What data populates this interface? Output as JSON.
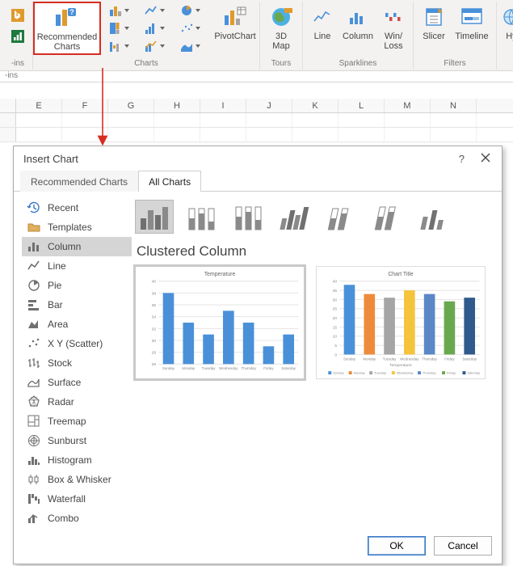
{
  "ribbon": {
    "groups": {
      "illustrations_label": "-ins",
      "addins": {
        "label": "-ins"
      },
      "charts": {
        "recommended": "Recommended\nCharts",
        "pivot": "PivotChart",
        "label": "Charts"
      },
      "tours": {
        "map": "3D\nMap",
        "label": "Tours"
      },
      "sparklines": {
        "line": "Line",
        "column": "Column",
        "winloss": "Win/\nLoss",
        "label": "Sparklines"
      },
      "filters": {
        "slicer": "Slicer",
        "timeline": "Timeline",
        "label": "Filters"
      },
      "hyperlinks": {
        "h": "Hy"
      }
    }
  },
  "sheet": {
    "cols": [
      "E",
      "F",
      "G",
      "H",
      "I",
      "J",
      "K",
      "L",
      "M",
      "N"
    ]
  },
  "dialog": {
    "title": "Insert Chart",
    "help": "?",
    "tabs": {
      "recommended": "Recommended Charts",
      "all": "All Charts"
    },
    "categories": [
      "Recent",
      "Templates",
      "Column",
      "Line",
      "Pie",
      "Bar",
      "Area",
      "X Y (Scatter)",
      "Stock",
      "Surface",
      "Radar",
      "Treemap",
      "Sunburst",
      "Histogram",
      "Box & Whisker",
      "Waterfall",
      "Combo"
    ],
    "chart_type_title": "Clustered Column",
    "preview1_title": "Temperature",
    "preview2_title": "Chart Title",
    "preview2_axis_title": "Temperature",
    "ok": "OK",
    "cancel": "Cancel"
  },
  "chart_data": [
    {
      "type": "bar",
      "title": "Temperature",
      "categories": [
        "Sunday",
        "Monday",
        "Tuesday",
        "Wednesday",
        "Thursday",
        "Friday",
        "Saturday"
      ],
      "values": [
        38,
        33,
        31,
        35,
        33,
        29,
        31
      ],
      "ylim": [
        26,
        40
      ],
      "y_ticks": [
        26,
        28,
        30,
        32,
        34,
        36,
        38,
        40
      ],
      "series_color": "#4a90d9"
    },
    {
      "type": "bar",
      "title": "Chart Title",
      "xlabel": "Temperature",
      "categories": [
        "Sunday",
        "Monday",
        "Tuesday",
        "Wednesday",
        "Thursday",
        "Friday",
        "Saturday"
      ],
      "values": [
        38,
        33,
        31,
        35,
        33,
        29,
        31
      ],
      "series_colors": [
        "#4a90d9",
        "#ed8b3b",
        "#a5a5a5",
        "#f6c33c",
        "#5b87c7",
        "#6aa84f",
        "#2f5a8b"
      ],
      "ylim": [
        0,
        40
      ],
      "y_ticks": [
        0,
        5,
        10,
        15,
        20,
        25,
        30,
        35,
        40
      ],
      "legend": [
        "Sunday",
        "Monday",
        "Tuesday",
        "Wednesday",
        "Thursday",
        "Friday",
        "Saturday"
      ]
    }
  ]
}
